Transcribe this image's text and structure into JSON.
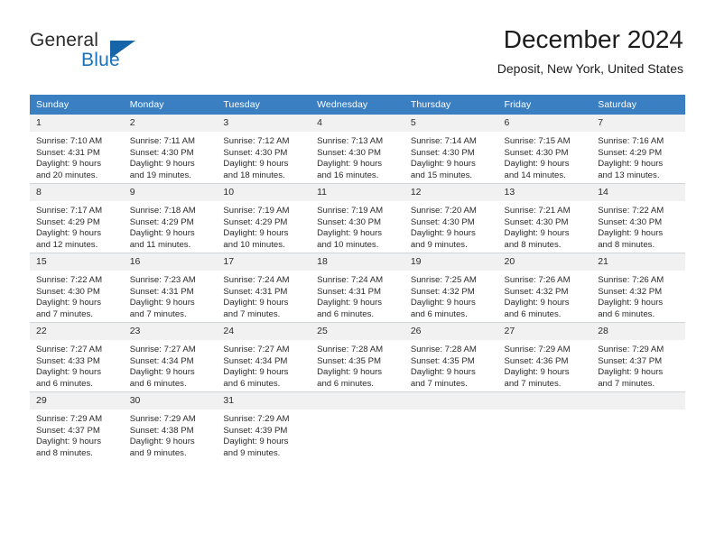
{
  "brand": {
    "name_part1": "General",
    "name_part2": "Blue",
    "accent_color": "#1971bb",
    "triangle_color": "#1565a8"
  },
  "header": {
    "title": "December 2024",
    "subtitle": "Deposit, New York, United States"
  },
  "calendar": {
    "header_bg": "#3a7fc1",
    "daynum_bg": "#f1f1f1",
    "weekdays": [
      "Sunday",
      "Monday",
      "Tuesday",
      "Wednesday",
      "Thursday",
      "Friday",
      "Saturday"
    ],
    "weeks": [
      [
        {
          "day": "1",
          "sunrise": "Sunrise: 7:10 AM",
          "sunset": "Sunset: 4:31 PM",
          "daylight1": "Daylight: 9 hours",
          "daylight2": "and 20 minutes."
        },
        {
          "day": "2",
          "sunrise": "Sunrise: 7:11 AM",
          "sunset": "Sunset: 4:30 PM",
          "daylight1": "Daylight: 9 hours",
          "daylight2": "and 19 minutes."
        },
        {
          "day": "3",
          "sunrise": "Sunrise: 7:12 AM",
          "sunset": "Sunset: 4:30 PM",
          "daylight1": "Daylight: 9 hours",
          "daylight2": "and 18 minutes."
        },
        {
          "day": "4",
          "sunrise": "Sunrise: 7:13 AM",
          "sunset": "Sunset: 4:30 PM",
          "daylight1": "Daylight: 9 hours",
          "daylight2": "and 16 minutes."
        },
        {
          "day": "5",
          "sunrise": "Sunrise: 7:14 AM",
          "sunset": "Sunset: 4:30 PM",
          "daylight1": "Daylight: 9 hours",
          "daylight2": "and 15 minutes."
        },
        {
          "day": "6",
          "sunrise": "Sunrise: 7:15 AM",
          "sunset": "Sunset: 4:30 PM",
          "daylight1": "Daylight: 9 hours",
          "daylight2": "and 14 minutes."
        },
        {
          "day": "7",
          "sunrise": "Sunrise: 7:16 AM",
          "sunset": "Sunset: 4:29 PM",
          "daylight1": "Daylight: 9 hours",
          "daylight2": "and 13 minutes."
        }
      ],
      [
        {
          "day": "8",
          "sunrise": "Sunrise: 7:17 AM",
          "sunset": "Sunset: 4:29 PM",
          "daylight1": "Daylight: 9 hours",
          "daylight2": "and 12 minutes."
        },
        {
          "day": "9",
          "sunrise": "Sunrise: 7:18 AM",
          "sunset": "Sunset: 4:29 PM",
          "daylight1": "Daylight: 9 hours",
          "daylight2": "and 11 minutes."
        },
        {
          "day": "10",
          "sunrise": "Sunrise: 7:19 AM",
          "sunset": "Sunset: 4:29 PM",
          "daylight1": "Daylight: 9 hours",
          "daylight2": "and 10 minutes."
        },
        {
          "day": "11",
          "sunrise": "Sunrise: 7:19 AM",
          "sunset": "Sunset: 4:30 PM",
          "daylight1": "Daylight: 9 hours",
          "daylight2": "and 10 minutes."
        },
        {
          "day": "12",
          "sunrise": "Sunrise: 7:20 AM",
          "sunset": "Sunset: 4:30 PM",
          "daylight1": "Daylight: 9 hours",
          "daylight2": "and 9 minutes."
        },
        {
          "day": "13",
          "sunrise": "Sunrise: 7:21 AM",
          "sunset": "Sunset: 4:30 PM",
          "daylight1": "Daylight: 9 hours",
          "daylight2": "and 8 minutes."
        },
        {
          "day": "14",
          "sunrise": "Sunrise: 7:22 AM",
          "sunset": "Sunset: 4:30 PM",
          "daylight1": "Daylight: 9 hours",
          "daylight2": "and 8 minutes."
        }
      ],
      [
        {
          "day": "15",
          "sunrise": "Sunrise: 7:22 AM",
          "sunset": "Sunset: 4:30 PM",
          "daylight1": "Daylight: 9 hours",
          "daylight2": "and 7 minutes."
        },
        {
          "day": "16",
          "sunrise": "Sunrise: 7:23 AM",
          "sunset": "Sunset: 4:31 PM",
          "daylight1": "Daylight: 9 hours",
          "daylight2": "and 7 minutes."
        },
        {
          "day": "17",
          "sunrise": "Sunrise: 7:24 AM",
          "sunset": "Sunset: 4:31 PM",
          "daylight1": "Daylight: 9 hours",
          "daylight2": "and 7 minutes."
        },
        {
          "day": "18",
          "sunrise": "Sunrise: 7:24 AM",
          "sunset": "Sunset: 4:31 PM",
          "daylight1": "Daylight: 9 hours",
          "daylight2": "and 6 minutes."
        },
        {
          "day": "19",
          "sunrise": "Sunrise: 7:25 AM",
          "sunset": "Sunset: 4:32 PM",
          "daylight1": "Daylight: 9 hours",
          "daylight2": "and 6 minutes."
        },
        {
          "day": "20",
          "sunrise": "Sunrise: 7:26 AM",
          "sunset": "Sunset: 4:32 PM",
          "daylight1": "Daylight: 9 hours",
          "daylight2": "and 6 minutes."
        },
        {
          "day": "21",
          "sunrise": "Sunrise: 7:26 AM",
          "sunset": "Sunset: 4:32 PM",
          "daylight1": "Daylight: 9 hours",
          "daylight2": "and 6 minutes."
        }
      ],
      [
        {
          "day": "22",
          "sunrise": "Sunrise: 7:27 AM",
          "sunset": "Sunset: 4:33 PM",
          "daylight1": "Daylight: 9 hours",
          "daylight2": "and 6 minutes."
        },
        {
          "day": "23",
          "sunrise": "Sunrise: 7:27 AM",
          "sunset": "Sunset: 4:34 PM",
          "daylight1": "Daylight: 9 hours",
          "daylight2": "and 6 minutes."
        },
        {
          "day": "24",
          "sunrise": "Sunrise: 7:27 AM",
          "sunset": "Sunset: 4:34 PM",
          "daylight1": "Daylight: 9 hours",
          "daylight2": "and 6 minutes."
        },
        {
          "day": "25",
          "sunrise": "Sunrise: 7:28 AM",
          "sunset": "Sunset: 4:35 PM",
          "daylight1": "Daylight: 9 hours",
          "daylight2": "and 6 minutes."
        },
        {
          "day": "26",
          "sunrise": "Sunrise: 7:28 AM",
          "sunset": "Sunset: 4:35 PM",
          "daylight1": "Daylight: 9 hours",
          "daylight2": "and 7 minutes."
        },
        {
          "day": "27",
          "sunrise": "Sunrise: 7:29 AM",
          "sunset": "Sunset: 4:36 PM",
          "daylight1": "Daylight: 9 hours",
          "daylight2": "and 7 minutes."
        },
        {
          "day": "28",
          "sunrise": "Sunrise: 7:29 AM",
          "sunset": "Sunset: 4:37 PM",
          "daylight1": "Daylight: 9 hours",
          "daylight2": "and 7 minutes."
        }
      ],
      [
        {
          "day": "29",
          "sunrise": "Sunrise: 7:29 AM",
          "sunset": "Sunset: 4:37 PM",
          "daylight1": "Daylight: 9 hours",
          "daylight2": "and 8 minutes."
        },
        {
          "day": "30",
          "sunrise": "Sunrise: 7:29 AM",
          "sunset": "Sunset: 4:38 PM",
          "daylight1": "Daylight: 9 hours",
          "daylight2": "and 9 minutes."
        },
        {
          "day": "31",
          "sunrise": "Sunrise: 7:29 AM",
          "sunset": "Sunset: 4:39 PM",
          "daylight1": "Daylight: 9 hours",
          "daylight2": "and 9 minutes."
        },
        {
          "day": "",
          "sunrise": "",
          "sunset": "",
          "daylight1": "",
          "daylight2": ""
        },
        {
          "day": "",
          "sunrise": "",
          "sunset": "",
          "daylight1": "",
          "daylight2": ""
        },
        {
          "day": "",
          "sunrise": "",
          "sunset": "",
          "daylight1": "",
          "daylight2": ""
        },
        {
          "day": "",
          "sunrise": "",
          "sunset": "",
          "daylight1": "",
          "daylight2": ""
        }
      ]
    ]
  }
}
